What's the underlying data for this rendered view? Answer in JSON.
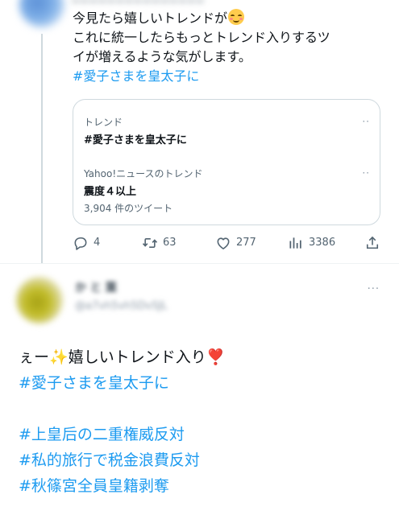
{
  "tweet1": {
    "header_blurred": "━ ━ ━ ━ ━ ━ ━ ━ ━ ━ ━ ━ ━ ━ ━",
    "text_line1": "今見たら嬉しいトレンドが",
    "text_line1_emoji": "smiling-face-with-blush-emoji",
    "text_line2": "これに統一したらもっとトレンド入りするツ",
    "text_line3": "イが増えるような気がします。",
    "hashtag": "#愛子さまを皇太子に",
    "trend_card": {
      "items": [
        {
          "context": "トレンド",
          "name": "#愛子さまを皇太子に",
          "more": "··"
        },
        {
          "context": "Yahoo!ニュースのトレンド",
          "name": "震度４以上",
          "count": "3,904 件のツイート",
          "more": "··"
        }
      ]
    },
    "actions": {
      "reply": {
        "icon": "reply-icon",
        "count": "4"
      },
      "retweet": {
        "icon": "retweet-icon",
        "count": "63"
      },
      "like": {
        "icon": "heart-icon",
        "count": "277"
      },
      "views": {
        "icon": "views-icon",
        "count": "3386"
      },
      "share": {
        "icon": "share-icon"
      }
    }
  },
  "tweet2": {
    "name_blurred": "か と 葉",
    "handle_blurred": "@a7vh5vh5DvSJL",
    "more": "···",
    "line1_prefix": "ぇー",
    "line1_sparkle": "✨",
    "line1_text": "嬉しいトレンド入り",
    "line1_mark": "❣️",
    "hashtags": [
      "#愛子さまを皇太子に",
      "#上皇后の二重権威反対",
      "#私的旅行で税金浪費反対",
      "#秋篠宮全員皇籍剥奪"
    ]
  },
  "colors": {
    "link": "#1d9bf0",
    "text": "#0f1419",
    "secondary": "#536471",
    "border": "#cfd9de"
  }
}
